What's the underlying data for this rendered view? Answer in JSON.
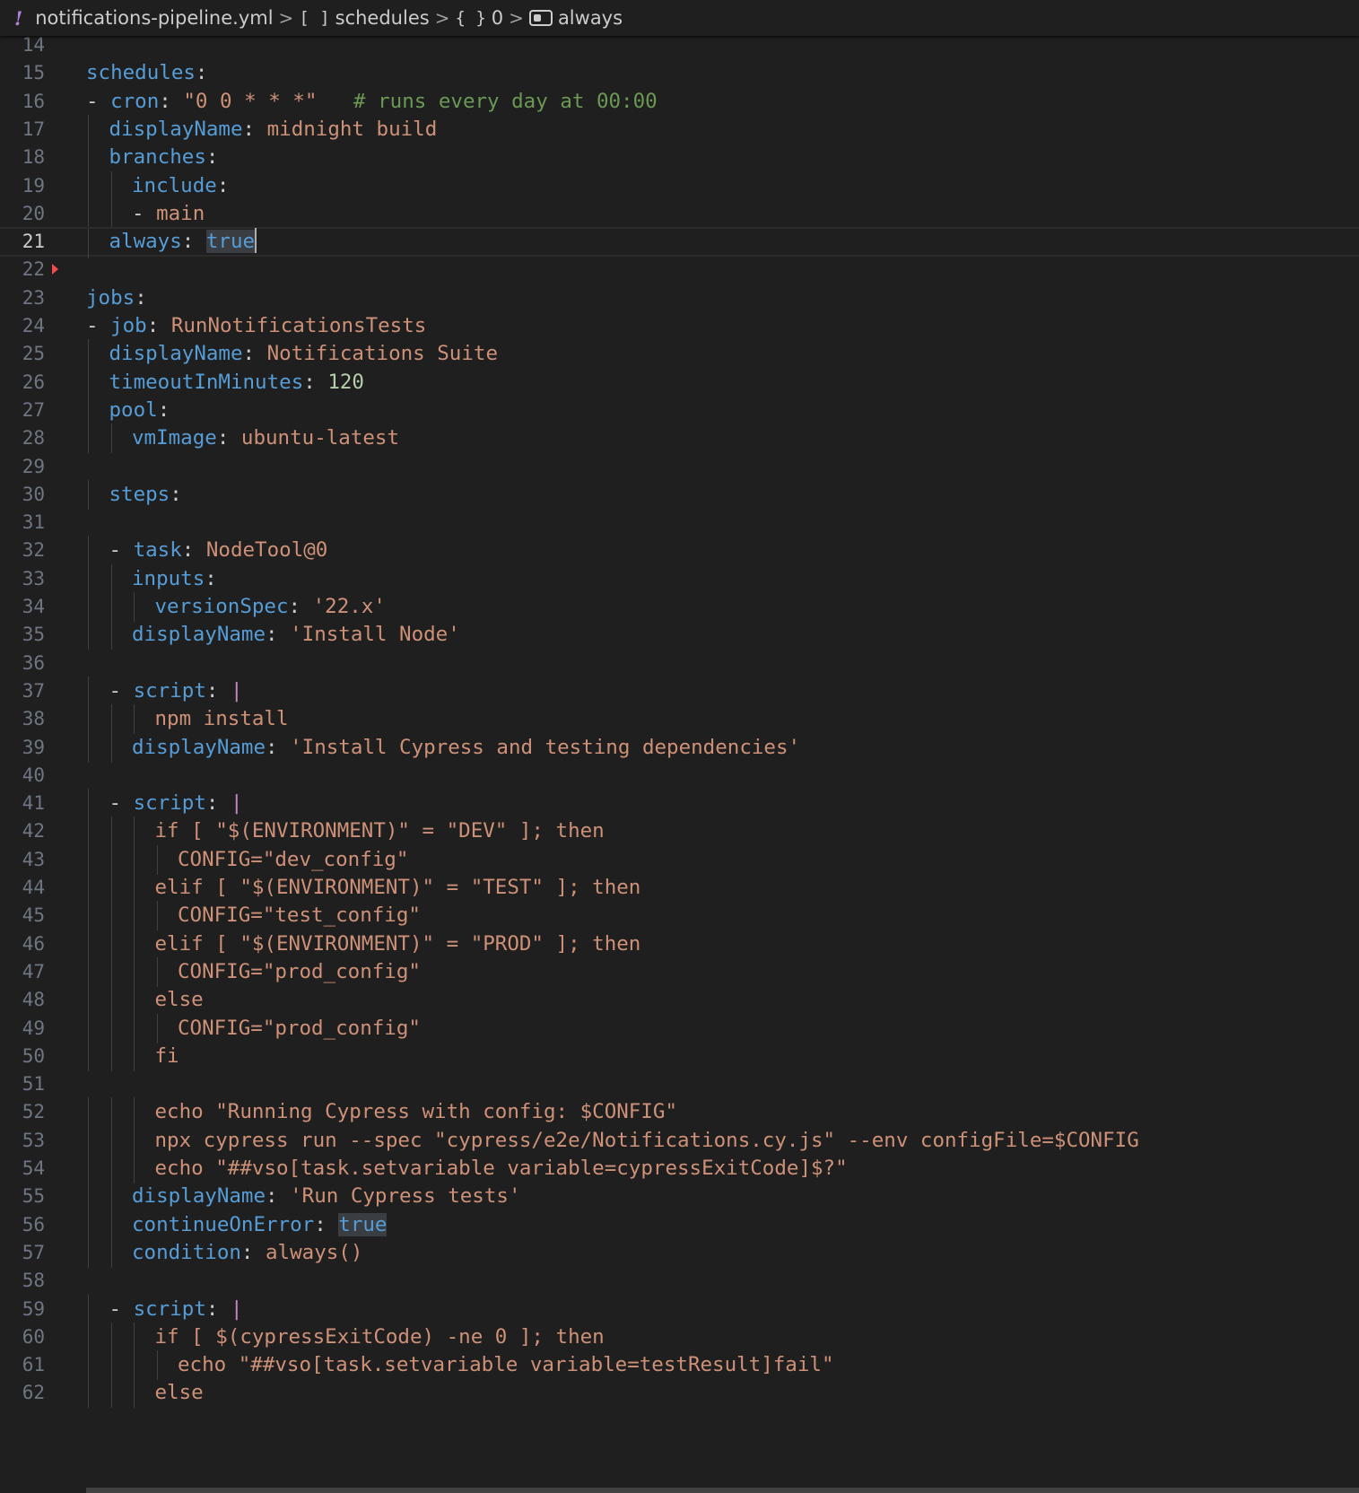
{
  "breadcrumb": {
    "warn_icon": "!",
    "file": "notifications-pipeline.yml",
    "sep": ">",
    "array_icon": "[ ]",
    "schedules": "schedules",
    "object_icon": "{ }",
    "index": "0",
    "bool_icon": "boolean-icon",
    "key": "always"
  },
  "editor": {
    "current_line": 21,
    "lines": [
      {
        "n": "14",
        "indent": 0,
        "t": []
      },
      {
        "n": "15",
        "indent": 0,
        "t": [
          [
            "k",
            "schedules"
          ],
          [
            "p",
            ":"
          ]
        ]
      },
      {
        "n": "16",
        "indent": 0,
        "t": [
          [
            "p",
            "- "
          ],
          [
            "k",
            "cron"
          ],
          [
            "p",
            ": "
          ],
          [
            "s",
            "\"0 0 * * *\""
          ],
          [
            "p",
            "   "
          ],
          [
            "c",
            "# runs every day at 00:00"
          ]
        ]
      },
      {
        "n": "17",
        "indent": 1,
        "t": [
          [
            "k",
            "displayName"
          ],
          [
            "p",
            ": "
          ],
          [
            "s",
            "midnight build"
          ]
        ]
      },
      {
        "n": "18",
        "indent": 1,
        "t": [
          [
            "k",
            "branches"
          ],
          [
            "p",
            ":"
          ]
        ]
      },
      {
        "n": "19",
        "indent": 2,
        "t": [
          [
            "k",
            "include"
          ],
          [
            "p",
            ":"
          ]
        ]
      },
      {
        "n": "20",
        "indent": 2,
        "t": [
          [
            "p",
            "- "
          ],
          [
            "s",
            "main"
          ]
        ]
      },
      {
        "n": "21",
        "indent": 1,
        "t": [
          [
            "k",
            "always"
          ],
          [
            "p",
            ": "
          ],
          [
            "b hl",
            "true"
          ]
        ]
      },
      {
        "n": "22",
        "indent": 0,
        "t": []
      },
      {
        "n": "23",
        "indent": 0,
        "t": [
          [
            "k",
            "jobs"
          ],
          [
            "p",
            ":"
          ]
        ]
      },
      {
        "n": "24",
        "indent": 0,
        "t": [
          [
            "p",
            "- "
          ],
          [
            "k",
            "job"
          ],
          [
            "p",
            ": "
          ],
          [
            "s",
            "RunNotificationsTests"
          ]
        ]
      },
      {
        "n": "25",
        "indent": 1,
        "t": [
          [
            "k",
            "displayName"
          ],
          [
            "p",
            ": "
          ],
          [
            "s",
            "Notifications Suite"
          ]
        ]
      },
      {
        "n": "26",
        "indent": 1,
        "t": [
          [
            "k",
            "timeoutInMinutes"
          ],
          [
            "p",
            ": "
          ],
          [
            "n",
            "120"
          ]
        ]
      },
      {
        "n": "27",
        "indent": 1,
        "t": [
          [
            "k",
            "pool"
          ],
          [
            "p",
            ":"
          ]
        ]
      },
      {
        "n": "28",
        "indent": 2,
        "t": [
          [
            "k",
            "vmImage"
          ],
          [
            "p",
            ": "
          ],
          [
            "s",
            "ubuntu-latest"
          ]
        ]
      },
      {
        "n": "29",
        "indent": 0,
        "t": []
      },
      {
        "n": "30",
        "indent": 1,
        "t": [
          [
            "k",
            "steps"
          ],
          [
            "p",
            ":"
          ]
        ]
      },
      {
        "n": "31",
        "indent": 0,
        "t": []
      },
      {
        "n": "32",
        "indent": 1,
        "t": [
          [
            "p",
            "- "
          ],
          [
            "k",
            "task"
          ],
          [
            "p",
            ": "
          ],
          [
            "s",
            "NodeTool@0"
          ]
        ]
      },
      {
        "n": "33",
        "indent": 2,
        "t": [
          [
            "k",
            "inputs"
          ],
          [
            "p",
            ":"
          ]
        ]
      },
      {
        "n": "34",
        "indent": 3,
        "t": [
          [
            "k",
            "versionSpec"
          ],
          [
            "p",
            ": "
          ],
          [
            "s",
            "'22.x'"
          ]
        ]
      },
      {
        "n": "35",
        "indent": 2,
        "t": [
          [
            "k",
            "displayName"
          ],
          [
            "p",
            ": "
          ],
          [
            "s",
            "'Install Node'"
          ]
        ]
      },
      {
        "n": "36",
        "indent": 0,
        "t": []
      },
      {
        "n": "37",
        "indent": 1,
        "t": [
          [
            "p",
            "- "
          ],
          [
            "k",
            "script"
          ],
          [
            "p",
            ": "
          ],
          [
            "pipe",
            "|"
          ]
        ]
      },
      {
        "n": "38",
        "indent": 3,
        "t": [
          [
            "s",
            "npm install"
          ]
        ]
      },
      {
        "n": "39",
        "indent": 2,
        "t": [
          [
            "k",
            "displayName"
          ],
          [
            "p",
            ": "
          ],
          [
            "s",
            "'Install Cypress and testing dependencies'"
          ]
        ]
      },
      {
        "n": "40",
        "indent": 0,
        "t": []
      },
      {
        "n": "41",
        "indent": 1,
        "t": [
          [
            "p",
            "- "
          ],
          [
            "k",
            "script"
          ],
          [
            "p",
            ": "
          ],
          [
            "pipe",
            "|"
          ]
        ]
      },
      {
        "n": "42",
        "indent": 3,
        "t": [
          [
            "s",
            "if [ \"$(ENVIRONMENT)\" = \"DEV\" ]; then"
          ]
        ]
      },
      {
        "n": "43",
        "indent": 4,
        "t": [
          [
            "s",
            "CONFIG=\"dev_config\""
          ]
        ]
      },
      {
        "n": "44",
        "indent": 3,
        "t": [
          [
            "s",
            "elif [ \"$(ENVIRONMENT)\" = \"TEST\" ]; then"
          ]
        ]
      },
      {
        "n": "45",
        "indent": 4,
        "t": [
          [
            "s",
            "CONFIG=\"test_config\""
          ]
        ]
      },
      {
        "n": "46",
        "indent": 3,
        "t": [
          [
            "s",
            "elif [ \"$(ENVIRONMENT)\" = \"PROD\" ]; then"
          ]
        ]
      },
      {
        "n": "47",
        "indent": 4,
        "t": [
          [
            "s",
            "CONFIG=\"prod_config\""
          ]
        ]
      },
      {
        "n": "48",
        "indent": 3,
        "t": [
          [
            "s",
            "else"
          ]
        ]
      },
      {
        "n": "49",
        "indent": 4,
        "t": [
          [
            "s",
            "CONFIG=\"prod_config\""
          ]
        ]
      },
      {
        "n": "50",
        "indent": 3,
        "t": [
          [
            "s",
            "fi"
          ]
        ]
      },
      {
        "n": "51",
        "indent": 0,
        "t": []
      },
      {
        "n": "52",
        "indent": 3,
        "t": [
          [
            "s",
            "echo \"Running Cypress with config: $CONFIG\""
          ]
        ]
      },
      {
        "n": "53",
        "indent": 3,
        "t": [
          [
            "s",
            "npx cypress run --spec \"cypress/e2e/Notifications.cy.js\" --env configFile=$CONFIG"
          ]
        ]
      },
      {
        "n": "54",
        "indent": 3,
        "t": [
          [
            "s",
            "echo \"##vso[task.setvariable variable=cypressExitCode]$?\""
          ]
        ]
      },
      {
        "n": "55",
        "indent": 2,
        "t": [
          [
            "k",
            "displayName"
          ],
          [
            "p",
            ": "
          ],
          [
            "s",
            "'Run Cypress tests'"
          ]
        ]
      },
      {
        "n": "56",
        "indent": 2,
        "t": [
          [
            "k",
            "continueOnError"
          ],
          [
            "p",
            ": "
          ],
          [
            "b hl",
            "true"
          ]
        ]
      },
      {
        "n": "57",
        "indent": 2,
        "t": [
          [
            "k",
            "condition"
          ],
          [
            "p",
            ": "
          ],
          [
            "s",
            "always()"
          ]
        ]
      },
      {
        "n": "58",
        "indent": 0,
        "t": []
      },
      {
        "n": "59",
        "indent": 1,
        "t": [
          [
            "p",
            "- "
          ],
          [
            "k",
            "script"
          ],
          [
            "p",
            ": "
          ],
          [
            "pipe",
            "|"
          ]
        ]
      },
      {
        "n": "60",
        "indent": 3,
        "t": [
          [
            "s",
            "if [ $(cypressExitCode) -ne 0 ]; then"
          ]
        ]
      },
      {
        "n": "61",
        "indent": 4,
        "t": [
          [
            "s",
            "echo \"##vso[task.setvariable variable=testResult]fail\""
          ]
        ]
      },
      {
        "n": "62",
        "indent": 3,
        "t": [
          [
            "s",
            "else"
          ]
        ]
      }
    ]
  }
}
